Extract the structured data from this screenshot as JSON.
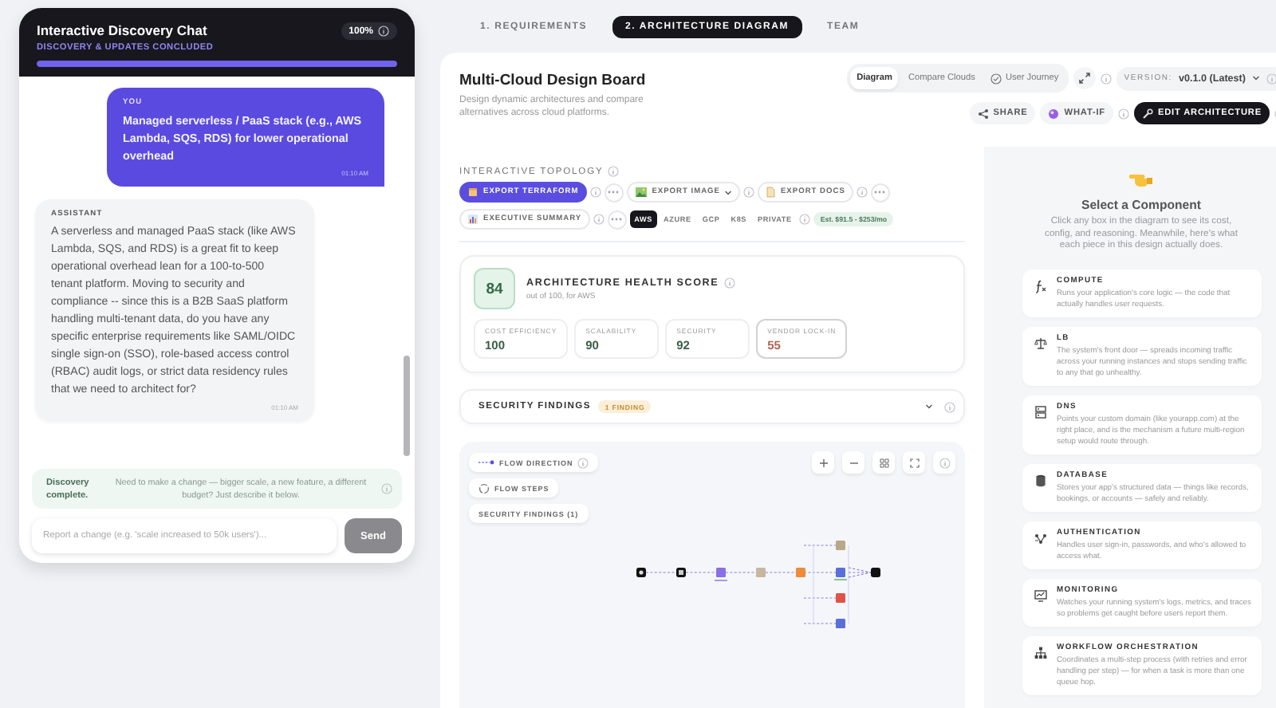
{
  "chat": {
    "title": "Interactive Discovery Chat",
    "subtitle": "DISCOVERY & UPDATES CONCLUDED",
    "progress": {
      "reading": "100%",
      "level": 1
    },
    "messages": [
      {
        "kind": "user",
        "author": "YOU",
        "text": "Managed serverless / PaaS stack (e.g., AWS Lambda, SQS, RDS) for lower operational overhead",
        "time": "01:10 AM"
      },
      {
        "kind": "assistant",
        "author": "ASSISTANT",
        "text": "A serverless and managed PaaS stack (like AWS Lambda, SQS, and RDS) is a great fit to keep operational overhead lean for a 100-to-500 tenant platform. Moving to security and compliance -- since this is a B2B SaaS platform handling multi-tenant data, do you have any specific enterprise requirements like SAML/OIDC single sign-on (SSO), role-based access control (RBAC) audit logs, or strict data residency rules that we need to architect for?",
        "time": "01:10 AM"
      }
    ],
    "notice": {
      "title": "Discovery complete.",
      "text": "Need to make a change — bigger scale, a new feature, a different budget? Just describe it below."
    },
    "input": {
      "placeholder": "Report a change (e.g. 'scale increased to 50k users')..."
    },
    "send": "Send"
  },
  "tabs": [
    {
      "label": "1. REQUIREMENTS",
      "selected": false
    },
    {
      "label": "2. ARCHITECTURE DIAGRAM",
      "selected": true
    },
    {
      "label": "TEAM",
      "selected": false
    }
  ],
  "board": {
    "title": "Multi-Cloud Design Board",
    "subtitle": "Design dynamic architectures and compare alternatives across cloud platforms.",
    "views": [
      {
        "label": "Diagram",
        "selected": true,
        "kind": "plain"
      },
      {
        "label": "Compare Clouds",
        "selected": false,
        "kind": "plain"
      },
      {
        "label": "User Journey",
        "selected": false,
        "kind": "journey"
      }
    ],
    "version": {
      "label": "VERSION:",
      "value": "v0.1.0 (Latest)"
    },
    "actions": [
      {
        "label": "SHARE",
        "kind": "share",
        "primary": false
      },
      {
        "label": "WHAT-IF",
        "kind": "whatif",
        "primary": false
      },
      {
        "label": "EDIT ARCHITECTURE",
        "kind": "edit",
        "primary": true
      }
    ]
  },
  "topology": {
    "label": "INTERACTIVE TOPOLOGY",
    "exports": [
      {
        "label": "EXPORT TERRAFORM",
        "kind": "terraform",
        "primary": true,
        "more": true
      },
      {
        "label": "EXPORT IMAGE",
        "kind": "image",
        "primary": false,
        "more": false
      },
      {
        "label": "EXPORT DOCS",
        "kind": "docs",
        "primary": false,
        "more": true
      },
      {
        "label": "EXECUTIVE SUMMARY",
        "kind": "summary",
        "primary": false,
        "more": true
      }
    ],
    "providers": [
      {
        "label": "AWS",
        "selected": true
      },
      {
        "label": "AZURE",
        "selected": false
      },
      {
        "label": "GCP",
        "selected": false
      },
      {
        "label": "K8S",
        "selected": false
      },
      {
        "label": "PRIVATE",
        "selected": false
      }
    ],
    "estimate": "Est. $91.5 - $253/mo"
  },
  "health": {
    "score": "84",
    "title": "ARCHITECTURE HEALTH SCORE",
    "subtitle": "out of 100, for AWS",
    "metrics": [
      {
        "label": "COST EFFICIENCY",
        "value": "100",
        "color": "#3b5e48",
        "flagged": false
      },
      {
        "label": "SCALABILITY",
        "value": "90",
        "color": "#3b5e48",
        "flagged": false
      },
      {
        "label": "SECURITY",
        "value": "92",
        "color": "#3b5e48",
        "flagged": false
      },
      {
        "label": "VENDOR LOCK-IN",
        "value": "55",
        "color": "#b4634f",
        "flagged": true
      }
    ]
  },
  "findings": {
    "title": "SECURITY FINDINGS",
    "badge": "1 FINDING",
    "expanded": false
  },
  "canvas": {
    "legend": [
      {
        "label": "FLOW DIRECTION",
        "kind": "flow"
      },
      {
        "label": "FLOW STEPS",
        "kind": "steps"
      },
      {
        "label": "SECURITY FINDINGS (1)",
        "kind": "findings"
      }
    ]
  },
  "sidebar": {
    "title": "Select a Component",
    "text": "Click any box in the diagram to see its cost, config, and reasoning. Meanwhile, here's what each piece in this design actually does.",
    "components": [
      {
        "name": "COMPUTE",
        "kind": "compute",
        "text": "Runs your application's core logic — the code that actually handles user requests."
      },
      {
        "name": "LB",
        "kind": "lb",
        "text": "The system's front door — spreads incoming traffic across your running instances and stops sending traffic to any that go unhealthy."
      },
      {
        "name": "DNS",
        "kind": "dns",
        "text": "Points your custom domain (like yourapp.com) at the right place, and is the mechanism a future multi-region setup would route through."
      },
      {
        "name": "DATABASE",
        "kind": "database",
        "text": "Stores your app's structured data — things like records, bookings, or accounts — safely and reliably."
      },
      {
        "name": "AUTHENTICATION",
        "kind": "auth",
        "text": "Handles user sign-in, passwords, and who's allowed to access what."
      },
      {
        "name": "MONITORING",
        "kind": "monitoring",
        "text": "Watches your running system's logs, metrics, and traces so problems get caught before users report them."
      },
      {
        "name": "WORKFLOW ORCHESTRATION",
        "kind": "workflow",
        "text": "Coordinates a multi-step process (with retries and error handling per step) — for when a task is more than one queue hop."
      }
    ]
  }
}
